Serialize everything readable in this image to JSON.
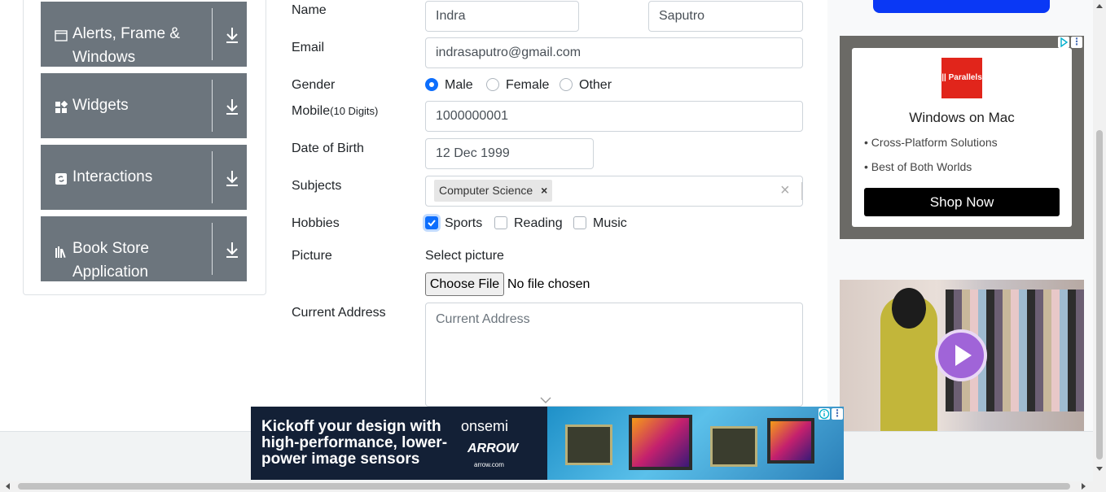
{
  "sidebar": {
    "groups": [
      {
        "label": "Alerts, Frame & Windows",
        "icon": "window-icon"
      },
      {
        "label": "Widgets",
        "icon": "widgets-icon"
      },
      {
        "label": "Interactions",
        "icon": "interactions-icon"
      },
      {
        "label": "Book Store Application",
        "icon": "book-icon"
      }
    ]
  },
  "form": {
    "name_label": "Name",
    "first_name": "Indra",
    "last_name": "Saputro",
    "email_label": "Email",
    "email": "indrasaputro@gmail.com",
    "gender_label": "Gender",
    "gender_options": [
      "Male",
      "Female",
      "Other"
    ],
    "gender_selected": "Male",
    "mobile_label": "Mobile",
    "mobile_hint": "(10 Digits)",
    "mobile": "1000000001",
    "dob_label": "Date of Birth",
    "dob": "12 Dec 1999",
    "subjects_label": "Subjects",
    "subject_chip": "Computer Science",
    "chip_remove": "×",
    "subjects_clear": "×",
    "hobbies_label": "Hobbies",
    "hobbies": [
      "Sports",
      "Reading",
      "Music"
    ],
    "hobbies_checked": [
      "Sports"
    ],
    "picture_label": "Picture",
    "picture_select": "Select picture",
    "choose_file": "Choose File",
    "no_file": "No file chosen",
    "address_label": "Current Address",
    "address_placeholder": "Current Address"
  },
  "ads": {
    "right_ad": {
      "brand": "|| Parallels",
      "title": "Windows on Mac",
      "bullets": [
        "• Cross-Platform Solutions",
        "• Best of Both Worlds"
      ],
      "cta": "Shop Now"
    },
    "bottom_ad": {
      "headline": "Kickoff your design with high-performance, lower-power image sensors",
      "brand1": "onsemi",
      "brand2": "ARROW",
      "brand2_url": "arrow.com"
    }
  },
  "colors": {
    "sidebar_group_bg": "#6c757d",
    "accent": "#0d6efd",
    "ad_cta_bg": "#000000",
    "parallels_red": "#e1251b"
  }
}
